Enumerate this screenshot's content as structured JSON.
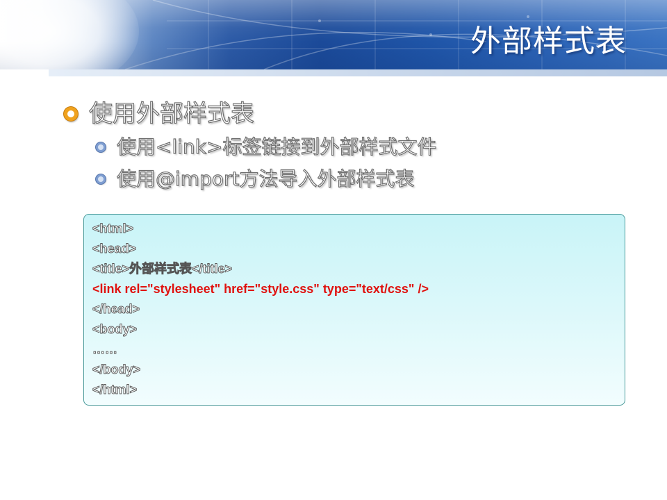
{
  "slide": {
    "title": "外部样式表"
  },
  "bullets": {
    "level1": "使用外部样式表",
    "level2": [
      "使用<link>标签链接到外部样式文件",
      "使用@import方法导入外部样式表"
    ]
  },
  "code": {
    "lines": [
      "<html>",
      "<head>",
      "<title>外部样式表</title>",
      "<link rel=\"stylesheet\"  href=\"style.css\"  type=\"text/css\"  />",
      "</head>",
      "<body>",
      "……",
      "</body>",
      "</html>"
    ],
    "highlight_color": "#e0120f",
    "box_color": "#c9f4f8"
  },
  "colors": {
    "title_text": "#ffffff",
    "banner_blue": "#1b4a99",
    "bullet_orange": "#f0a21e",
    "sub_bullet_blue": "#7f9ed1"
  },
  "icons": {
    "level1_bullet": "orange-ring-bullet-icon",
    "level2_bullet": "blue-dot-bullet-icon"
  }
}
